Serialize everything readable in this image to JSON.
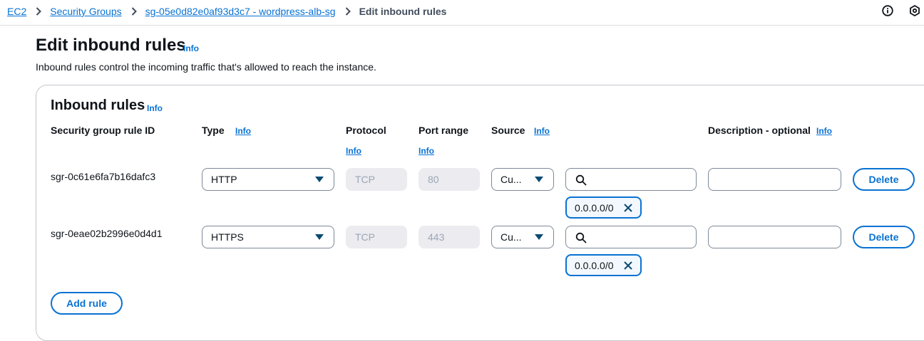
{
  "breadcrumb": {
    "items": [
      "EC2",
      "Security Groups",
      "sg-05e0d82e0af93d3c7 - wordpress-alb-sg"
    ],
    "current": "Edit inbound rules"
  },
  "top_icons": [
    "info-circle-icon",
    "settings-hex-icon"
  ],
  "page": {
    "title": "Edit inbound rules",
    "info": "Info",
    "description": "Inbound rules control the incoming traffic that's allowed to reach the instance."
  },
  "panel": {
    "title": "Inbound rules",
    "info": "Info",
    "columns": {
      "rule_id": "Security group rule ID",
      "type": "Type",
      "type_info": "Info",
      "protocol": "Protocol",
      "protocol_info": "Info",
      "port_range": "Port range",
      "port_range_info": "Info",
      "source": "Source",
      "source_info": "Info",
      "description": "Description - optional",
      "description_info": "Info"
    },
    "rules": [
      {
        "id": "sgr-0c61e6fa7b16dafc3",
        "type": "HTTP",
        "protocol": "TCP",
        "port_range": "80",
        "source_type": "Cu...",
        "source_search": "",
        "source_token": "0.0.0.0/0",
        "description": "",
        "delete_label": "Delete"
      },
      {
        "id": "sgr-0eae02b2996e0d4d1",
        "type": "HTTPS",
        "protocol": "TCP",
        "port_range": "443",
        "source_type": "Cu...",
        "source_search": "",
        "source_token": "0.0.0.0/0",
        "description": "",
        "delete_label": "Delete"
      }
    ],
    "add_rule_label": "Add rule"
  },
  "colors": {
    "link": "#0972d3",
    "token_bg": "#f2f8fd",
    "disabled_bg": "#ebebf0"
  }
}
